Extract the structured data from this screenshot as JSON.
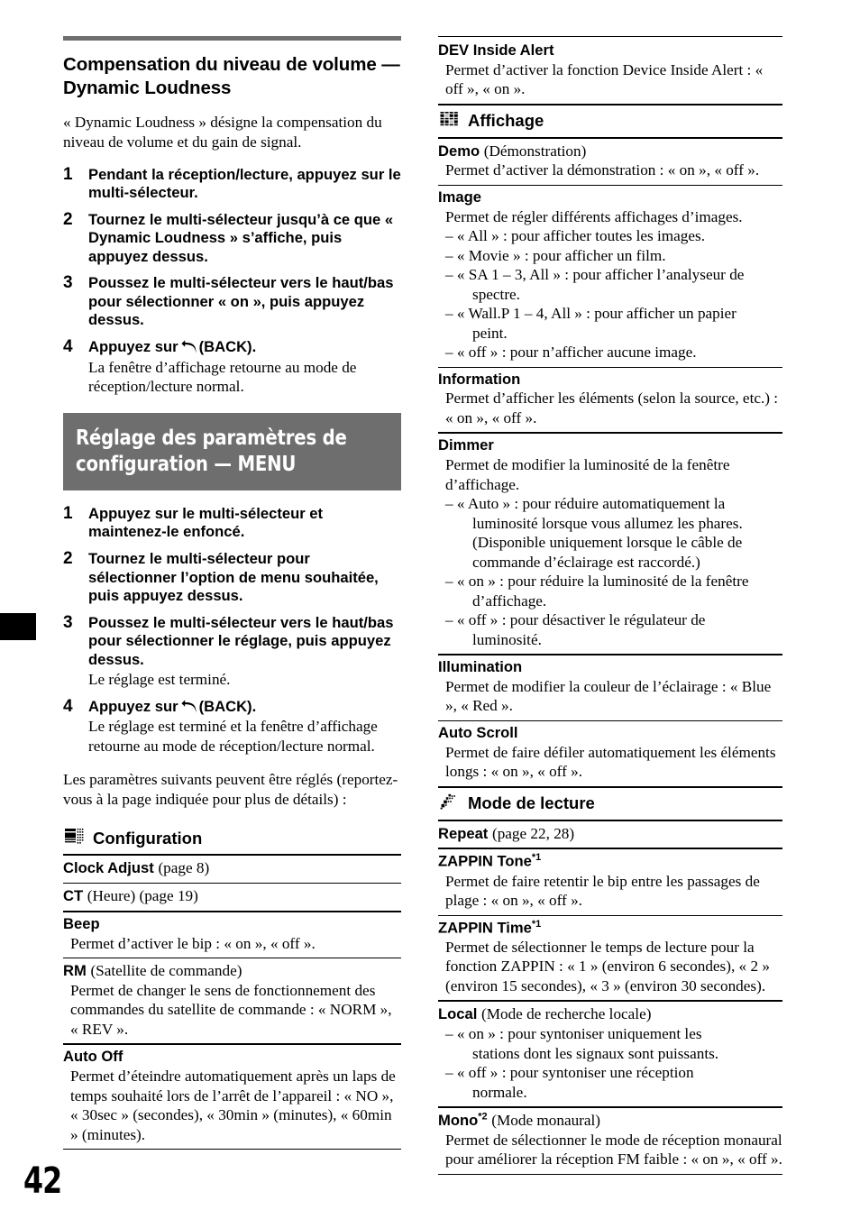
{
  "page": {
    "folio": "42"
  },
  "left": {
    "chapter_title": "Compensation du niveau de volume — Dynamic Loudness",
    "intro": "« Dynamic Loudness » désigne la compensation du niveau de volume et du gain de signal.",
    "steps_loudness": [
      {
        "num": "1",
        "text": "Pendant la réception/lecture, appuyez sur le multi-sélecteur.",
        "note": ""
      },
      {
        "num": "2",
        "text": "Tournez le multi-sélecteur jusqu’à ce que « Dynamic Loudness » s’affiche, puis appuyez dessus.",
        "note": ""
      },
      {
        "num": "3",
        "text": "Poussez le multi-sélecteur vers le haut/bas pour sélectionner « on », puis appuyez dessus.",
        "note": ""
      },
      {
        "num": "4",
        "text_before": "Appuyez sur",
        "icon": "back-icon",
        "text_after": "(BACK).",
        "note": "La fenêtre d’affichage retourne au mode de réception/lecture normal."
      }
    ],
    "banner_title": "Réglage des paramètres de configuration — MENU",
    "steps_menu": [
      {
        "num": "1",
        "text": "Appuyez sur le multi-sélecteur et maintenez-le enfoncé.",
        "note": ""
      },
      {
        "num": "2",
        "text": "Tournez le multi-sélecteur pour sélectionner l’option de menu souhaitée, puis appuyez dessus.",
        "note": ""
      },
      {
        "num": "3",
        "text": "Poussez le multi-sélecteur vers le haut/bas pour sélectionner le réglage, puis appuyez dessus.",
        "note": "Le réglage est terminé."
      },
      {
        "num": "4",
        "text_before": "Appuyez sur",
        "icon": "back-icon",
        "text_after": "(BACK).",
        "note": "Le réglage est terminé et la fenêtre d’affichage retourne au mode de réception/lecture normal."
      }
    ],
    "outro": "Les paramètres suivants peuvent être réglés (reportez-vous à la page indiquée pour plus de détails) :",
    "section_config": {
      "icon": "display-panel-icon",
      "title": "Configuration",
      "entries": [
        {
          "term": "Clock Adjust",
          "term_note": "(page 8)",
          "desc": ""
        },
        {
          "term": "CT",
          "term_note": "(Heure) (page 19)",
          "desc": ""
        },
        {
          "term": "Beep",
          "term_note": "",
          "desc": "Permet d’activer le bip : « on », « off »."
        },
        {
          "term": "RM",
          "term_note": "(Satellite de commande)",
          "desc": "Permet de changer le sens de fonctionnement des commandes du satellite de commande : « NORM », « REV »."
        },
        {
          "term": "Auto Off",
          "term_note": "",
          "desc": "Permet d’éteindre automatiquement après un laps de temps souhaité lors de l’arrêt de l’appareil : « NO », « 30sec » (secondes), « 30min » (minutes), « 60min » (minutes)."
        }
      ]
    }
  },
  "right": {
    "entry_dev_alert": {
      "term": "DEV Inside Alert",
      "term_note": "",
      "desc": "Permet d’activer la fonction Device Inside Alert : « off », « on »."
    },
    "section_affichage": {
      "icon": "display-grid-icon",
      "title": "Affichage",
      "entries": [
        {
          "term": "Demo",
          "term_note": "(Démonstration)",
          "desc": "Permet d’activer la démonstration : « on », « off »."
        },
        {
          "term": "Image",
          "term_note": "",
          "desc": "Permet de régler différents affichages d’images.",
          "subs": [
            {
              "text": "– « All » : pour afficher toutes les images.",
              "cont": ""
            },
            {
              "text": "– « Movie » : pour afficher un film.",
              "cont": ""
            },
            {
              "text": "– « SA 1 – 3, All » : pour afficher l’analyseur de",
              "cont": "spectre."
            },
            {
              "text": "– « Wall.P 1 – 4, All » : pour afficher un papier",
              "cont": "peint."
            },
            {
              "text": "– « off » : pour n’afficher aucune image.",
              "cont": ""
            }
          ]
        },
        {
          "term": "Information",
          "term_note": "",
          "desc": "Permet d’afficher les éléments (selon la source, etc.) : « on », « off »."
        },
        {
          "term": "Dimmer",
          "term_note": "",
          "desc": "Permet de modifier la luminosité de la fenêtre d’affichage.",
          "subs": [
            {
              "text": "– « Auto » : pour réduire automatiquement la",
              "cont": "luminosité lorsque vous allumez les phares. (Disponible uniquement lorsque le câble de commande d’éclairage est raccordé.)"
            },
            {
              "text": "– « on » : pour réduire la luminosité de la fenêtre",
              "cont": "d’affichage."
            },
            {
              "text": "– « off » : pour désactiver le régulateur de",
              "cont": "luminosité."
            }
          ]
        },
        {
          "term": "Illumination",
          "term_note": "",
          "desc": "Permet de modifier la couleur de l’éclairage : « Blue », « Red »."
        },
        {
          "term": "Auto Scroll",
          "term_note": "",
          "desc": "Permet de faire défiler automatiquement les éléments longs : « on », « off »."
        }
      ]
    },
    "section_lecture": {
      "icon": "playback-mode-icon",
      "title": "Mode de lecture",
      "entries": [
        {
          "term": "Repeat",
          "term_note": "(page 22, 28)",
          "desc": ""
        },
        {
          "term": "ZAPPIN Tone",
          "sup": "*1",
          "term_note": "",
          "desc": "Permet de faire retentir le bip entre les passages de plage : « on », « off »."
        },
        {
          "term": "ZAPPIN Time",
          "sup": "*1",
          "term_note": "",
          "desc": "Permet de sélectionner le temps de lecture pour la fonction ZAPPIN : « 1 » (environ 6 secondes), « 2 » (environ 15 secondes), « 3 » (environ 30 secondes)."
        },
        {
          "term": "Local",
          "term_note": "(Mode de recherche locale)",
          "desc": "",
          "subs": [
            {
              "text": "– « on » : pour syntoniser uniquement les",
              "cont": "stations dont les signaux sont puissants."
            },
            {
              "text": "– « off » : pour syntoniser une réception",
              "cont": "normale."
            }
          ]
        },
        {
          "term": "Mono",
          "sup": "*2",
          "term_note": "(Mode monaural)",
          "desc": "Permet de sélectionner le mode de réception monaural pour améliorer la réception FM faible : « on », « off »."
        }
      ]
    }
  },
  "colors": {
    "banner_gray": "#6e6e6e",
    "rule_black": "#000000",
    "page_bg": "#ffffff"
  }
}
